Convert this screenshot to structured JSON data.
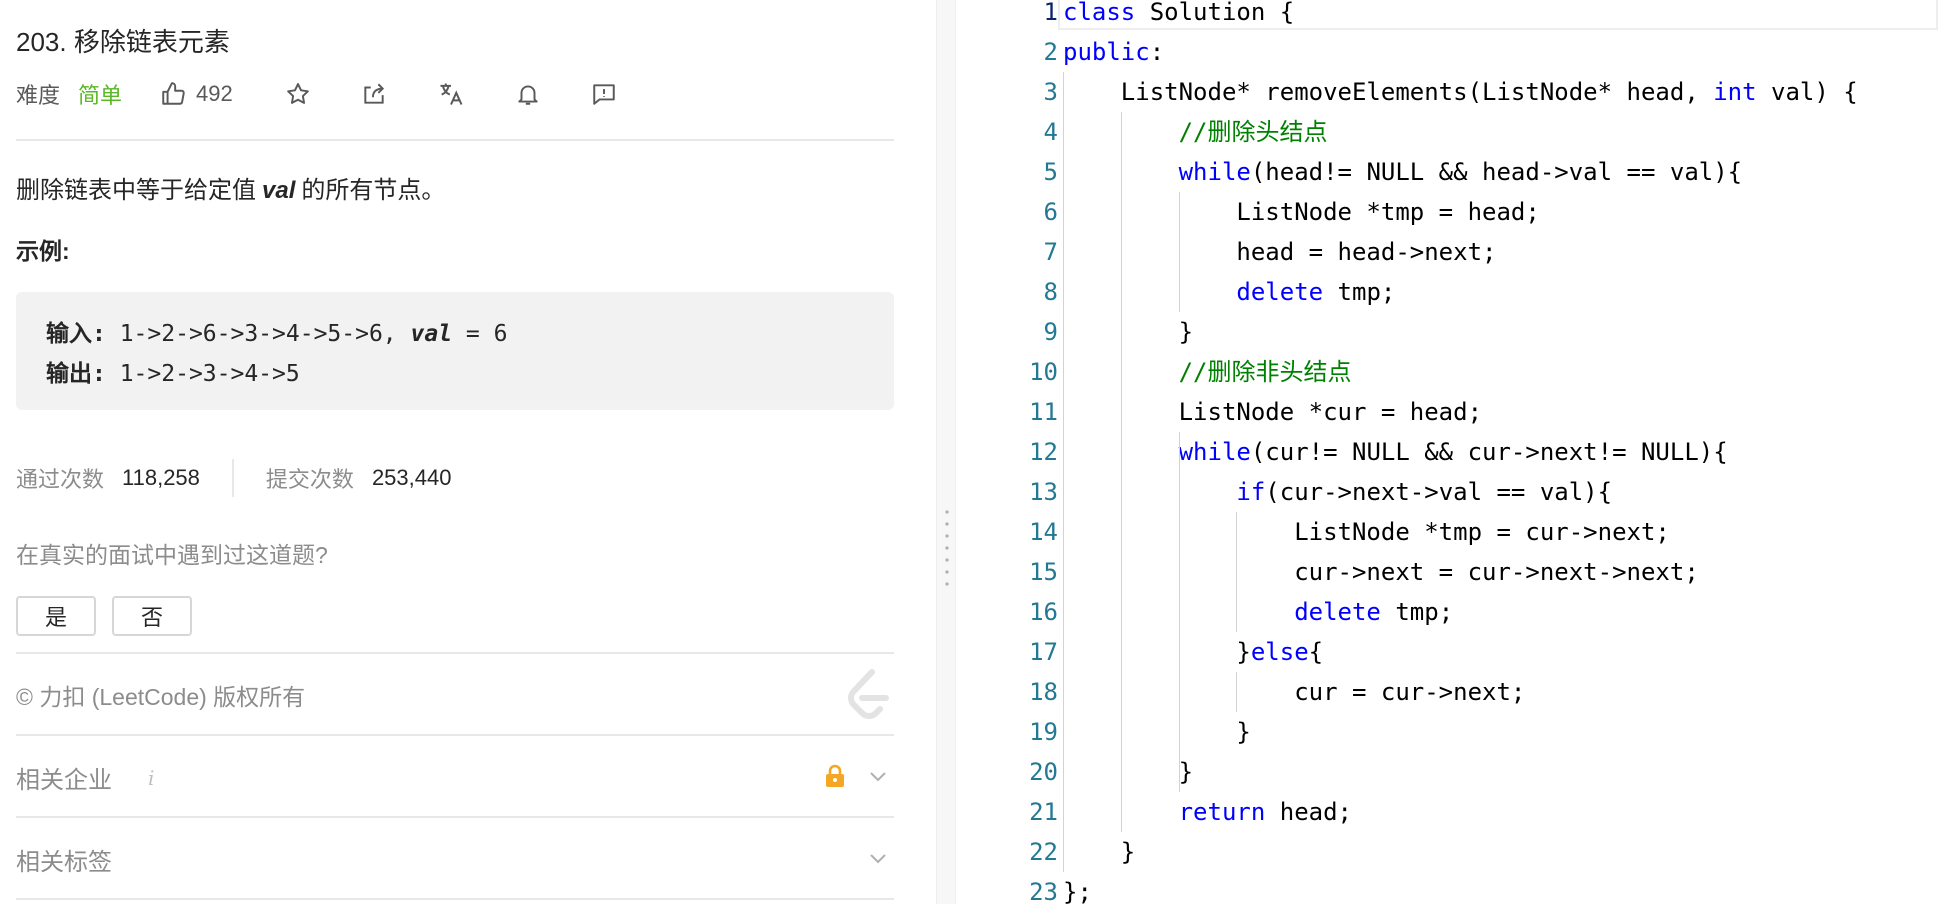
{
  "problem": {
    "title": "203. 移除链表元素",
    "difficulty_label": "难度",
    "difficulty": "简单",
    "likes": "492",
    "description_before": "删除链表中等于给定值",
    "description_var": "val",
    "description_after": "的所有节点。",
    "example_label": "示例:",
    "example": {
      "input_label": "输入:",
      "input_value": " 1->2->6->3->4->5->6, ",
      "input_var": "val",
      "input_tail": " = 6",
      "output_label": "输出:",
      "output_value": " 1->2->3->4->5"
    },
    "stats": {
      "accepted_label": "通过次数",
      "accepted_value": "118,258",
      "submitted_label": "提交次数",
      "submitted_value": "253,440"
    },
    "interview_question": "在真实的面试中遇到过这道题?",
    "yes_label": "是",
    "no_label": "否",
    "copyright": "© 力扣 (LeetCode) 版权所有",
    "related_companies": "相关企业",
    "info_glyph": "i",
    "related_tags": "相关标签"
  },
  "icons": [
    "thumbs-up-icon",
    "star-icon",
    "share-icon",
    "translate-icon",
    "bell-icon",
    "feedback-icon",
    "leetcode-logo-icon",
    "lock-icon",
    "chevron-down-icon"
  ],
  "colors": {
    "easy": "#5ab726",
    "keyword": "#0000ff",
    "comment": "#008000",
    "line_number": "#237893",
    "lock": "#f5a623"
  },
  "editor": {
    "line_numbers": [
      "1",
      "2",
      "3",
      "4",
      "5",
      "6",
      "7",
      "8",
      "9",
      "10",
      "11",
      "12",
      "13",
      "14",
      "15",
      "16",
      "17",
      "18",
      "19",
      "20",
      "21",
      "22",
      "23"
    ],
    "lines": [
      [
        {
          "t": "class",
          "k": "kw"
        },
        {
          "t": " Solution {"
        }
      ],
      [
        {
          "t": "public",
          "k": "kw"
        },
        {
          "t": ":"
        }
      ],
      [
        {
          "t": "    ListNode* removeElements(ListNode* head, "
        },
        {
          "t": "int",
          "k": "kw"
        },
        {
          "t": " val) {"
        }
      ],
      [
        {
          "t": "        "
        },
        {
          "t": "//删除头结点",
          "k": "cm"
        }
      ],
      [
        {
          "t": "        "
        },
        {
          "t": "while",
          "k": "kw"
        },
        {
          "t": "(head!= NULL && head->val == val){"
        }
      ],
      [
        {
          "t": "            ListNode *tmp = head;"
        }
      ],
      [
        {
          "t": "            head = head->next;"
        }
      ],
      [
        {
          "t": "            "
        },
        {
          "t": "delete",
          "k": "kw"
        },
        {
          "t": " tmp;"
        }
      ],
      [
        {
          "t": "        }"
        }
      ],
      [
        {
          "t": "        "
        },
        {
          "t": "//删除非头结点",
          "k": "cm"
        }
      ],
      [
        {
          "t": "        ListNode *cur = head;"
        }
      ],
      [
        {
          "t": "        "
        },
        {
          "t": "while",
          "k": "kw"
        },
        {
          "t": "(cur!= NULL && cur->next!= NULL){"
        }
      ],
      [
        {
          "t": "            "
        },
        {
          "t": "if",
          "k": "kw"
        },
        {
          "t": "(cur->next->val == val){"
        }
      ],
      [
        {
          "t": "                ListNode *tmp = cur->next;"
        }
      ],
      [
        {
          "t": "                cur->next = cur->next->next;"
        }
      ],
      [
        {
          "t": "                "
        },
        {
          "t": "delete",
          "k": "kw"
        },
        {
          "t": " tmp;"
        }
      ],
      [
        {
          "t": "            }"
        },
        {
          "t": "else",
          "k": "kw"
        },
        {
          "t": "{"
        }
      ],
      [
        {
          "t": "                cur = cur->next;"
        }
      ],
      [
        {
          "t": "            }"
        }
      ],
      [
        {
          "t": "        }"
        }
      ],
      [
        {
          "t": "        "
        },
        {
          "t": "return",
          "k": "kw"
        },
        {
          "t": " head;"
        }
      ],
      [
        {
          "t": "    }"
        }
      ],
      [
        {
          "t": "};"
        }
      ]
    ]
  }
}
